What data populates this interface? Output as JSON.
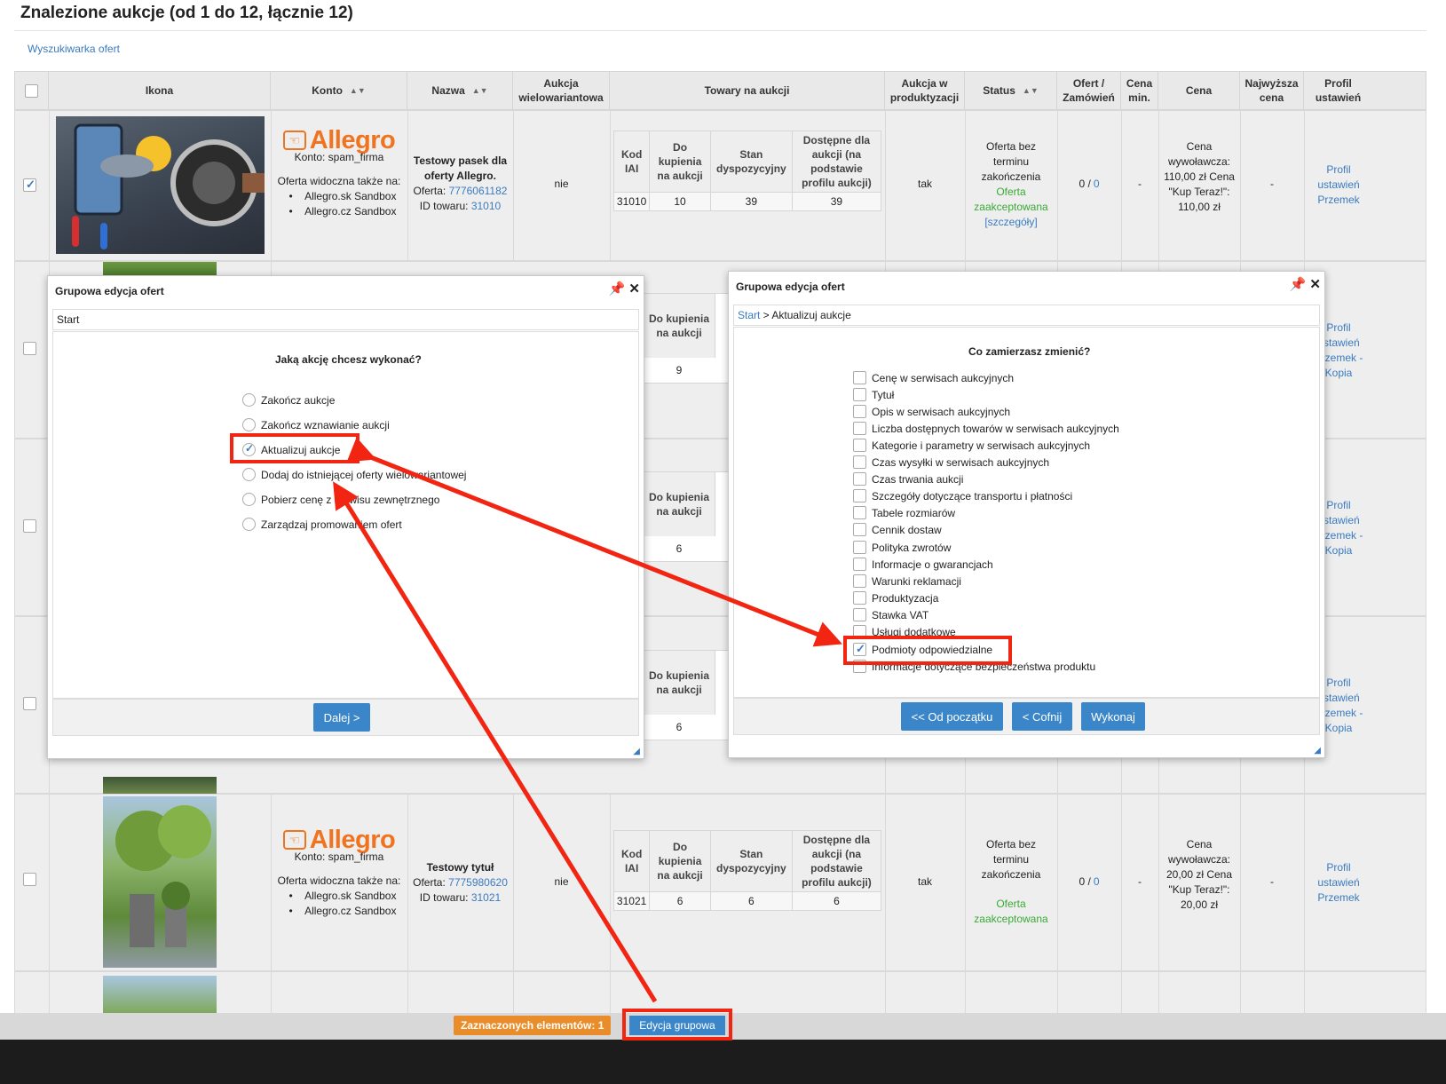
{
  "page": {
    "title": "Znalezione aukcje (od 1 do 12, łącznie 12)",
    "search_link": "Wyszukiwarka ofert"
  },
  "columns": {
    "icon": "Ikona",
    "account": "Konto",
    "name": "Nazwa",
    "multi_variant": "Aukcja wielowariantowa",
    "goods": "Towary na aukcji",
    "in_production": "Aukcja w produktyzacji",
    "status": "Status",
    "offers_orders": "Ofert / Zamówień",
    "min_price": "Cena min.",
    "price": "Cena",
    "highest_price": "Najwyższa cena",
    "settings_profile": "Profil ustawień"
  },
  "subtable_headers": {
    "code": "Kod IAI",
    "buy": "Do kupienia na aukcji",
    "stock": "Stan dyspozycyjny",
    "available": "Dostępne dla aukcji (na podstawie profilu aukcji)"
  },
  "rows": [
    {
      "checked": true,
      "brand": "Allegro",
      "account": "Konto: spam_firma",
      "visible_also": "Oferta widoczna także na:",
      "sites": [
        "Allegro.sk Sandbox",
        "Allegro.cz Sandbox"
      ],
      "name_title": "Testowy pasek dla oferty Allegro.",
      "offer_label": "Oferta:",
      "offer_id": "7776061182",
      "product_label": "ID towaru:",
      "product_id": "31010",
      "multi_variant": "nie",
      "goods": {
        "code": "31010",
        "buy": "10",
        "stock": "39",
        "available": "39"
      },
      "in_production": "tak",
      "status_line1": "Oferta bez terminu zakończenia",
      "status_line2": "Oferta zaakceptowana",
      "status_link": "[szczegóły]",
      "offers": "0 /",
      "orders": "0",
      "min_price": "-",
      "price": "Cena wywoławcza: 110,00 zł Cena \"Kup Teraz!\": 110,00 zł",
      "highest": "-",
      "profile": "Profil ustawień Przemek"
    },
    {
      "checked": false,
      "goods_buy": "9",
      "profile": "Profil ustawień Przemek - Kopia"
    },
    {
      "checked": false,
      "goods_buy": "6",
      "profile": "Profil ustawień Przemek - Kopia"
    },
    {
      "checked": false,
      "goods_buy": "6",
      "profile": "Profil ustawień Przemek - Kopia"
    },
    {
      "checked": false,
      "brand": "Allegro",
      "account": "Konto: spam_firma",
      "visible_also": "Oferta widoczna także na:",
      "sites": [
        "Allegro.sk Sandbox",
        "Allegro.cz Sandbox"
      ],
      "name_title": "Testowy tytuł",
      "offer_label": "Oferta:",
      "offer_id": "7775980620",
      "product_label": "ID towaru:",
      "product_id": "31021",
      "multi_variant": "nie",
      "goods": {
        "code": "31021",
        "buy": "6",
        "stock": "6",
        "available": "6"
      },
      "in_production": "tak",
      "status_line1": "Oferta bez terminu zakończenia",
      "status_line2": "Oferta zaakceptowana",
      "offers": "0 /",
      "orders": "0",
      "min_price": "-",
      "price": "Cena wywoławcza: 20,00 zł Cena \"Kup Teraz!\": 20,00 zł",
      "highest": "-",
      "profile": "Profil ustawień Przemek"
    }
  ],
  "dialog_left": {
    "title": "Grupowa edycja ofert",
    "breadcrumb": "Start",
    "question": "Jaką akcję chcesz wykonać?",
    "options": [
      {
        "label": "Zakończ aukcje",
        "selected": false
      },
      {
        "label": "Zakończ wznawianie aukcji",
        "selected": false
      },
      {
        "label": "Aktualizuj aukcje",
        "selected": true
      },
      {
        "label": "Dodaj do istniejącej oferty wielowariantowej",
        "selected": false
      },
      {
        "label": "Pobierz cenę z serwisu zewnętrznego",
        "selected": false
      },
      {
        "label": "Zarządzaj promowaniem ofert",
        "selected": false
      }
    ],
    "next_button": "Dalej >"
  },
  "dialog_right": {
    "title": "Grupowa edycja ofert",
    "breadcrumb_link": "Start",
    "breadcrumb_rest": " > Aktualizuj aukcje",
    "question": "Co zamierzasz zmienić?",
    "options": [
      {
        "label": "Cenę w serwisach aukcyjnych",
        "checked": false
      },
      {
        "label": "Tytuł",
        "checked": false
      },
      {
        "label": "Opis w serwisach aukcyjnych",
        "checked": false
      },
      {
        "label": "Liczba dostępnych towarów w serwisach aukcyjnych",
        "checked": false
      },
      {
        "label": "Kategorie i parametry w serwisach aukcyjnych",
        "checked": false
      },
      {
        "label": "Czas wysyłki w serwisach aukcyjnych",
        "checked": false
      },
      {
        "label": "Czas trwania aukcji",
        "checked": false
      },
      {
        "label": "Szczegóły dotyczące transportu i płatności",
        "checked": false
      },
      {
        "label": "Tabele rozmiarów",
        "checked": false
      },
      {
        "label": "Cennik dostaw",
        "checked": false
      },
      {
        "label": "Polityka zwrotów",
        "checked": false
      },
      {
        "label": "Informacje o gwarancjach",
        "checked": false
      },
      {
        "label": "Warunki reklamacji",
        "checked": false
      },
      {
        "label": "Produktyzacja",
        "checked": false
      },
      {
        "label": "Stawka VAT",
        "checked": false
      },
      {
        "label": "Usługi dodatkowe",
        "checked": false
      },
      {
        "label": "Podmioty odpowiedzialne",
        "checked": true
      },
      {
        "label": "Informacje dotyczące bezpieczeństwa produktu",
        "checked": false
      }
    ],
    "btn_start": "<< Od początku",
    "btn_back": "< Cofnij",
    "btn_execute": "Wykonaj"
  },
  "footer": {
    "selected_count": "Zaznaczonych elementów: 1",
    "group_edit": "Edycja grupowa"
  },
  "colors": {
    "accent_blue": "#3a86c8",
    "link_blue": "#3a7bc0",
    "allegro_orange": "#f07420",
    "highlight_red": "#f22412",
    "status_green": "#3aaa35",
    "badge_orange": "#e98d2a"
  }
}
